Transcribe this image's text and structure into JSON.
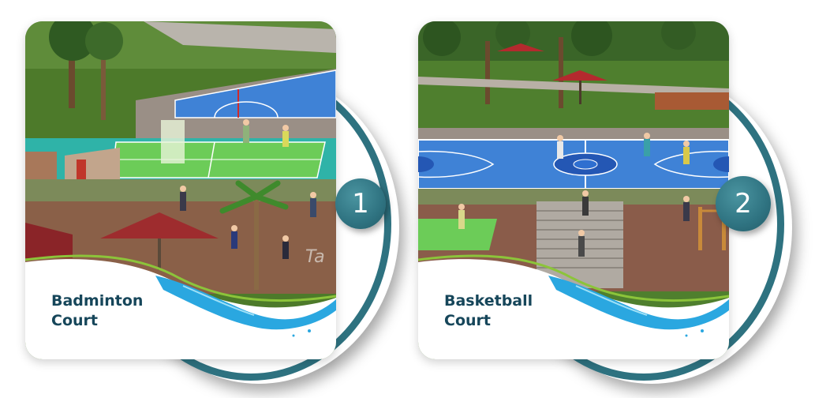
{
  "cards": [
    {
      "number": "1",
      "title": "Badminton\nCourt",
      "signage_text": "Ta"
    },
    {
      "number": "2",
      "title": "Basketball\nCourt"
    }
  ],
  "colors": {
    "accent_teal": "#2e7280",
    "label_text": "#16465a",
    "court_blue": "#3f82d6",
    "court_green": "#6ccc58",
    "grass": "#4f7a2c",
    "water": "#2aa7e0"
  },
  "icons": [
    "number-badge"
  ]
}
